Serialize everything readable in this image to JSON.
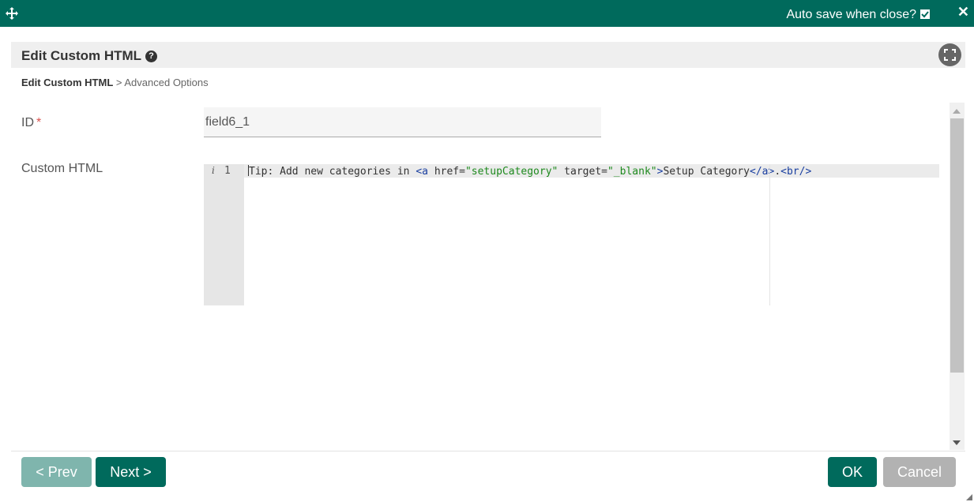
{
  "topbar": {
    "move_icon": "move-arrows-icon",
    "autosave_label": "Auto save when close?",
    "autosave_checked": true,
    "close_label": "✕"
  },
  "header": {
    "title": "Edit Custom HTML",
    "help_icon": "question-circle-icon",
    "fullscreen_icon": "fullscreen-icon"
  },
  "breadcrumb": {
    "current": "Edit Custom HTML",
    "separator": ">",
    "next": "Advanced Options"
  },
  "form": {
    "id_label": "ID",
    "id_required_mark": "*",
    "id_value": "field6_1",
    "custom_html_label": "Custom HTML"
  },
  "editor": {
    "gutter_info_mark": "i",
    "line_number": "1",
    "code_plain_1": "Tip: Add new categories in ",
    "code_tag_open_a": "<a ",
    "code_attr_href": "href=",
    "code_str_href": "\"setupCategory\"",
    "code_attr_target": " target=",
    "code_str_target": "\"_blank\"",
    "code_tag_gt": ">",
    "code_plain_2": "Setup Category",
    "code_tag_close_a": "</a>",
    "code_plain_3": ".",
    "code_tag_br": "<br/>",
    "colors": {
      "tag": "#1a3fa0",
      "string": "#1e8a1e",
      "text": "#333333"
    }
  },
  "footer": {
    "prev_label": "< Prev",
    "next_label": "Next >",
    "ok_label": "OK",
    "cancel_label": "Cancel"
  },
  "colors": {
    "brand": "#006a5c",
    "disabled_brand": "#7fb5ad",
    "cancel": "#b2b2b2"
  }
}
